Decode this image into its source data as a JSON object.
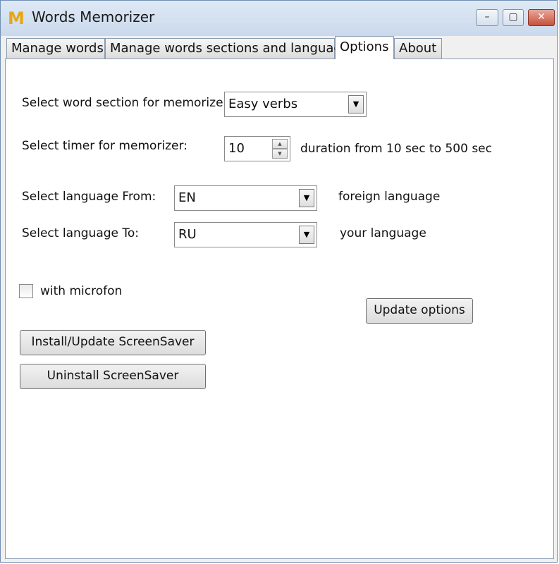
{
  "window": {
    "title": "Words Memorizer",
    "app_icon": "app-logo-icon",
    "controls": {
      "minimize": "–",
      "maximize": "▢",
      "close": "✕"
    }
  },
  "tabs": [
    {
      "label": "Manage words"
    },
    {
      "label": "Manage words sections and languages"
    },
    {
      "label": "Options"
    },
    {
      "label": "About"
    }
  ],
  "options": {
    "section_label": "Select word section for memorizer:",
    "section_value": "Easy verbs",
    "timer_label": "Select timer for memorizer:",
    "timer_value": "10",
    "timer_hint": "duration from 10 sec to 500 sec",
    "lang_from_label": "Select language From:",
    "lang_from_value": "EN",
    "lang_from_hint": "foreign language",
    "lang_to_label": "Select language To:",
    "lang_to_value": "RU",
    "lang_to_hint": "your language",
    "microfon_label": "with microfon",
    "microfon_checked": false,
    "update_button": "Update options",
    "install_button": "Install/Update ScreenSaver",
    "uninstall_button": "Uninstall ScreenSaver"
  },
  "glyphs": {
    "dropdown": "▼",
    "spin_up": "▲",
    "spin_down": "▼"
  }
}
